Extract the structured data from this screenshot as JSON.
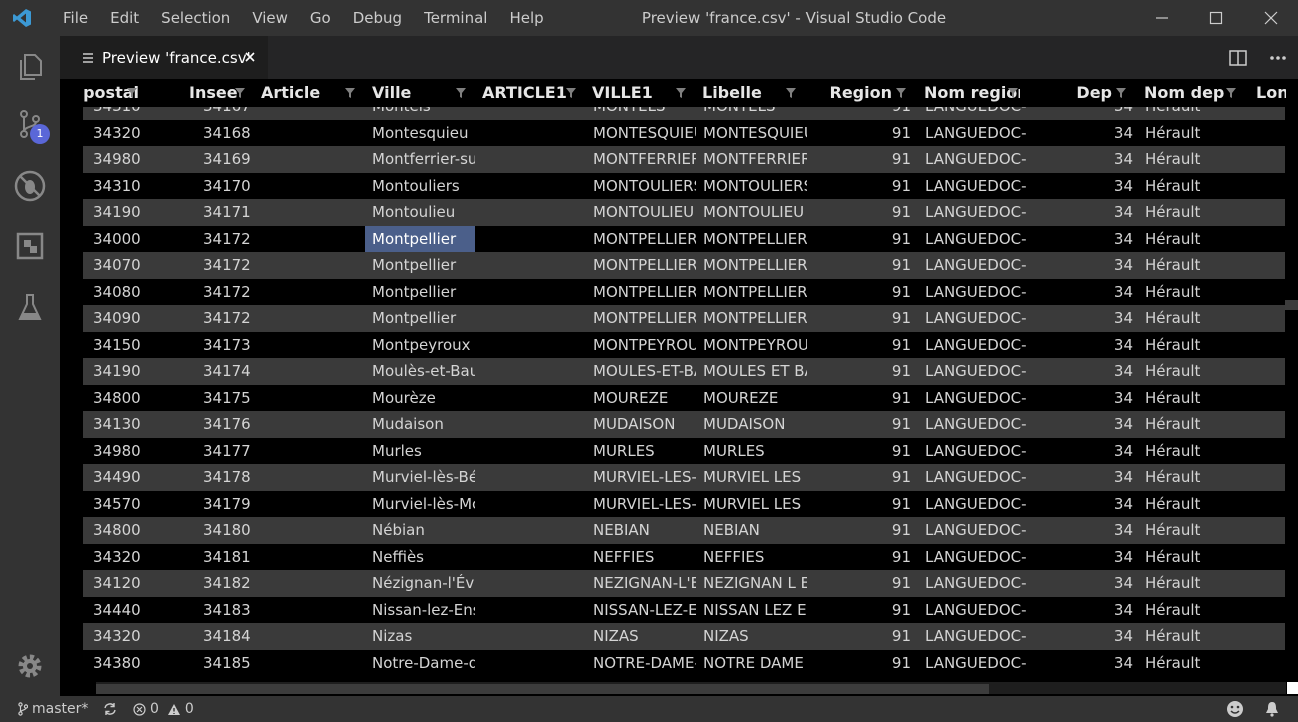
{
  "title_bar": {
    "menu": [
      "File",
      "Edit",
      "Selection",
      "View",
      "Go",
      "Debug",
      "Terminal",
      "Help"
    ],
    "window_title": "Preview 'france.csv' - Visual Studio Code"
  },
  "activity_bar": {
    "scm_badge": "1"
  },
  "tab": {
    "label": "Preview 'france.csv'"
  },
  "columns": {
    "postal": "postal",
    "insee": "Insee",
    "article": "Article",
    "ville": "Ville",
    "article1": "ARTICLE1",
    "ville1": "VILLE1",
    "libelle": "Libelle",
    "region": "Region",
    "nom_region": "Nom region",
    "dep": "Dep",
    "nom_dep": "Nom dep",
    "lon": "Lon"
  },
  "partial_row": {
    "postal": "34310",
    "insee": "34167",
    "ville": "Montels",
    "ville1": "MONTELS",
    "libelle": "MONTELS",
    "region": "91",
    "nom_region": "LANGUEDOC-F",
    "dep": "34",
    "nom_dep": "Hérault"
  },
  "rows": [
    {
      "postal": "34320",
      "insee": "34168",
      "ville": "Montesquieu",
      "ville1": "MONTESQUIEU",
      "libelle": "MONTESQUIEU",
      "region": "91",
      "nom_region": "LANGUEDOC-F",
      "dep": "34",
      "nom_dep": "Hérault"
    },
    {
      "postal": "34980",
      "insee": "34169",
      "ville": "Montferrier-su",
      "ville1": "MONTFERRIER",
      "libelle": "MONTFERRIER",
      "region": "91",
      "nom_region": "LANGUEDOC-F",
      "dep": "34",
      "nom_dep": "Hérault"
    },
    {
      "postal": "34310",
      "insee": "34170",
      "ville": "Montouliers",
      "ville1": "MONTOULIERS",
      "libelle": "MONTOULIERS",
      "region": "91",
      "nom_region": "LANGUEDOC-F",
      "dep": "34",
      "nom_dep": "Hérault"
    },
    {
      "postal": "34190",
      "insee": "34171",
      "ville": "Montoulieu",
      "ville1": "MONTOULIEU",
      "libelle": "MONTOULIEU",
      "region": "91",
      "nom_region": "LANGUEDOC-F",
      "dep": "34",
      "nom_dep": "Hérault"
    },
    {
      "postal": "34000",
      "insee": "34172",
      "ville": "Montpellier",
      "ville1": "MONTPELLIER",
      "libelle": "MONTPELLIER",
      "region": "91",
      "nom_region": "LANGUEDOC-F",
      "dep": "34",
      "nom_dep": "Hérault",
      "selected": true
    },
    {
      "postal": "34070",
      "insee": "34172",
      "ville": "Montpellier",
      "ville1": "MONTPELLIER",
      "libelle": "MONTPELLIER",
      "region": "91",
      "nom_region": "LANGUEDOC-F",
      "dep": "34",
      "nom_dep": "Hérault"
    },
    {
      "postal": "34080",
      "insee": "34172",
      "ville": "Montpellier",
      "ville1": "MONTPELLIER",
      "libelle": "MONTPELLIER",
      "region": "91",
      "nom_region": "LANGUEDOC-F",
      "dep": "34",
      "nom_dep": "Hérault"
    },
    {
      "postal": "34090",
      "insee": "34172",
      "ville": "Montpellier",
      "ville1": "MONTPELLIER",
      "libelle": "MONTPELLIER",
      "region": "91",
      "nom_region": "LANGUEDOC-F",
      "dep": "34",
      "nom_dep": "Hérault"
    },
    {
      "postal": "34150",
      "insee": "34173",
      "ville": "Montpeyroux",
      "ville1": "MONTPEYROU",
      "libelle": "MONTPEYROU",
      "region": "91",
      "nom_region": "LANGUEDOC-F",
      "dep": "34",
      "nom_dep": "Hérault"
    },
    {
      "postal": "34190",
      "insee": "34174",
      "ville": "Moulès-et-Bau",
      "ville1": "MOULES-ET-BA",
      "libelle": "MOULES ET BA",
      "region": "91",
      "nom_region": "LANGUEDOC-F",
      "dep": "34",
      "nom_dep": "Hérault"
    },
    {
      "postal": "34800",
      "insee": "34175",
      "ville": "Mourèze",
      "ville1": "MOUREZE",
      "libelle": "MOUREZE",
      "region": "91",
      "nom_region": "LANGUEDOC-F",
      "dep": "34",
      "nom_dep": "Hérault"
    },
    {
      "postal": "34130",
      "insee": "34176",
      "ville": "Mudaison",
      "ville1": "MUDAISON",
      "libelle": "MUDAISON",
      "region": "91",
      "nom_region": "LANGUEDOC-F",
      "dep": "34",
      "nom_dep": "Hérault"
    },
    {
      "postal": "34980",
      "insee": "34177",
      "ville": "Murles",
      "ville1": "MURLES",
      "libelle": "MURLES",
      "region": "91",
      "nom_region": "LANGUEDOC-F",
      "dep": "34",
      "nom_dep": "Hérault"
    },
    {
      "postal": "34490",
      "insee": "34178",
      "ville": "Murviel-lès-Bé",
      "ville1": "MURVIEL-LES-I",
      "libelle": "MURVIEL LES E",
      "region": "91",
      "nom_region": "LANGUEDOC-F",
      "dep": "34",
      "nom_dep": "Hérault"
    },
    {
      "postal": "34570",
      "insee": "34179",
      "ville": "Murviel-lès-Mc",
      "ville1": "MURVIEL-LES-I",
      "libelle": "MURVIEL LES N",
      "region": "91",
      "nom_region": "LANGUEDOC-F",
      "dep": "34",
      "nom_dep": "Hérault"
    },
    {
      "postal": "34800",
      "insee": "34180",
      "ville": "Nébian",
      "ville1": "NEBIAN",
      "libelle": "NEBIAN",
      "region": "91",
      "nom_region": "LANGUEDOC-F",
      "dep": "34",
      "nom_dep": "Hérault"
    },
    {
      "postal": "34320",
      "insee": "34181",
      "ville": "Neffiès",
      "ville1": "NEFFIES",
      "libelle": "NEFFIES",
      "region": "91",
      "nom_region": "LANGUEDOC-F",
      "dep": "34",
      "nom_dep": "Hérault"
    },
    {
      "postal": "34120",
      "insee": "34182",
      "ville": "Nézignan-l'Évê",
      "ville1": "NEZIGNAN-L'EV",
      "libelle": "NEZIGNAN L EV",
      "region": "91",
      "nom_region": "LANGUEDOC-F",
      "dep": "34",
      "nom_dep": "Hérault"
    },
    {
      "postal": "34440",
      "insee": "34183",
      "ville": "Nissan-lez-Ens",
      "ville1": "NISSAN-LEZ-EN",
      "libelle": "NISSAN LEZ EN",
      "region": "91",
      "nom_region": "LANGUEDOC-F",
      "dep": "34",
      "nom_dep": "Hérault"
    },
    {
      "postal": "34320",
      "insee": "34184",
      "ville": "Nizas",
      "ville1": "NIZAS",
      "libelle": "NIZAS",
      "region": "91",
      "nom_region": "LANGUEDOC-F",
      "dep": "34",
      "nom_dep": "Hérault"
    },
    {
      "postal": "34380",
      "insee": "34185",
      "ville": "Notre-Dame-d",
      "ville1": "NOTRE-DAME-",
      "libelle": "NOTRE DAME I",
      "region": "91",
      "nom_region": "LANGUEDOC-F",
      "dep": "34",
      "nom_dep": "Hérault"
    }
  ],
  "status_bar": {
    "branch": "master*",
    "errors": "0",
    "warnings": "0"
  },
  "colors": {
    "accent_badge": "#5a67d8",
    "selected_cell": "#4b5f8a",
    "alt_row": "#3a3a3a"
  }
}
